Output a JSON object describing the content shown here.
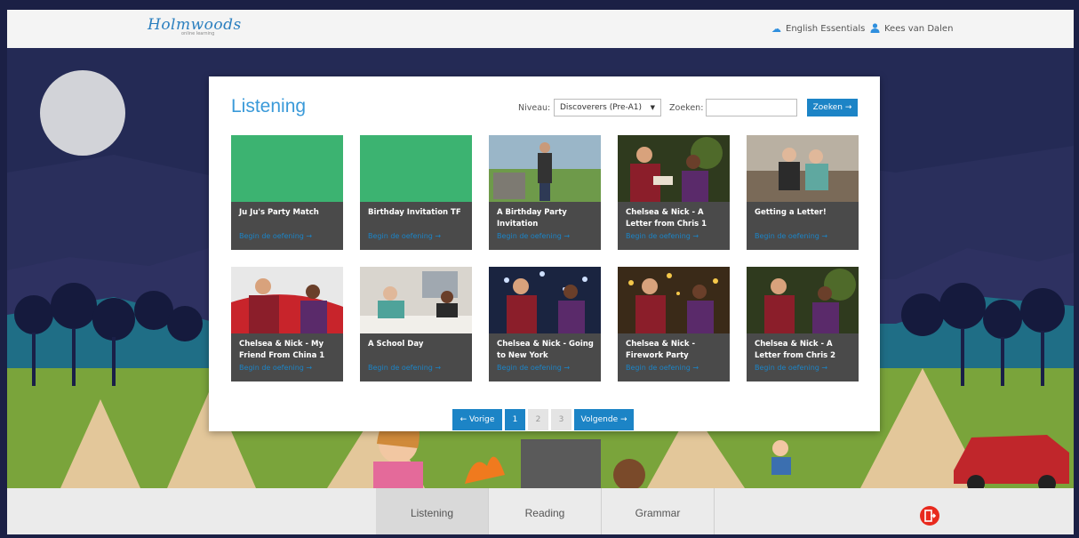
{
  "header": {
    "logo": "Holmwoods",
    "logo_sub": "online learning",
    "course_icon": "cloud-icon",
    "course": "English Essentials",
    "user_icon": "user-icon",
    "user": "Kees van Dalen"
  },
  "panel": {
    "title": "Listening",
    "niveau_label": "Niveau:",
    "niveau_value": "Discoverers (Pre-A1)",
    "zoeken_label": "Zoeken:",
    "zoeken_value": "",
    "zoeken_button": "Zoeken →"
  },
  "cards": [
    {
      "title": "Ju Ju's Party Match",
      "link": "Begin de oefening →",
      "thumb": "green"
    },
    {
      "title": "Birthday Invitation TF",
      "link": "Begin de oefening →",
      "thumb": "green"
    },
    {
      "title": "A Birthday Party Invitation",
      "link": "Begin de oefening →",
      "thumb": "garden"
    },
    {
      "title": "Chelsea & Nick - A Letter from Chris 1",
      "link": "Begin de oefening →",
      "thumb": "duo-forest"
    },
    {
      "title": "Getting a Letter!",
      "link": "Begin de oefening →",
      "thumb": "couch"
    },
    {
      "title": "Chelsea & Nick - My Friend From China 1",
      "link": "Begin de oefening →",
      "thumb": "duo-flag"
    },
    {
      "title": "A School Day",
      "link": "Begin de oefening →",
      "thumb": "kitchen"
    },
    {
      "title": "Chelsea & Nick - Going to New York",
      "link": "Begin de oefening →",
      "thumb": "duo-fireworks"
    },
    {
      "title": "Chelsea & Nick - Firework Party",
      "link": "Begin de oefening →",
      "thumb": "duo-lights"
    },
    {
      "title": "Chelsea & Nick - A Letter from Chris 2",
      "link": "Begin de oefening →",
      "thumb": "duo-forest"
    }
  ],
  "pagination": {
    "prev": "← Vorige",
    "pages": [
      "1",
      "2",
      "3"
    ],
    "current": "1",
    "next": "Volgende →"
  },
  "bottom_tabs": {
    "items": [
      "Listening",
      "Reading",
      "Grammar"
    ],
    "active": "Listening",
    "exit_icon": "exit-door-icon"
  },
  "colors": {
    "accent": "#1c84c6",
    "title_blue": "#3a9ad9",
    "card_bg": "#4a4a4a",
    "thumb_green": "#3cb371",
    "exit_red": "#e8291d"
  }
}
